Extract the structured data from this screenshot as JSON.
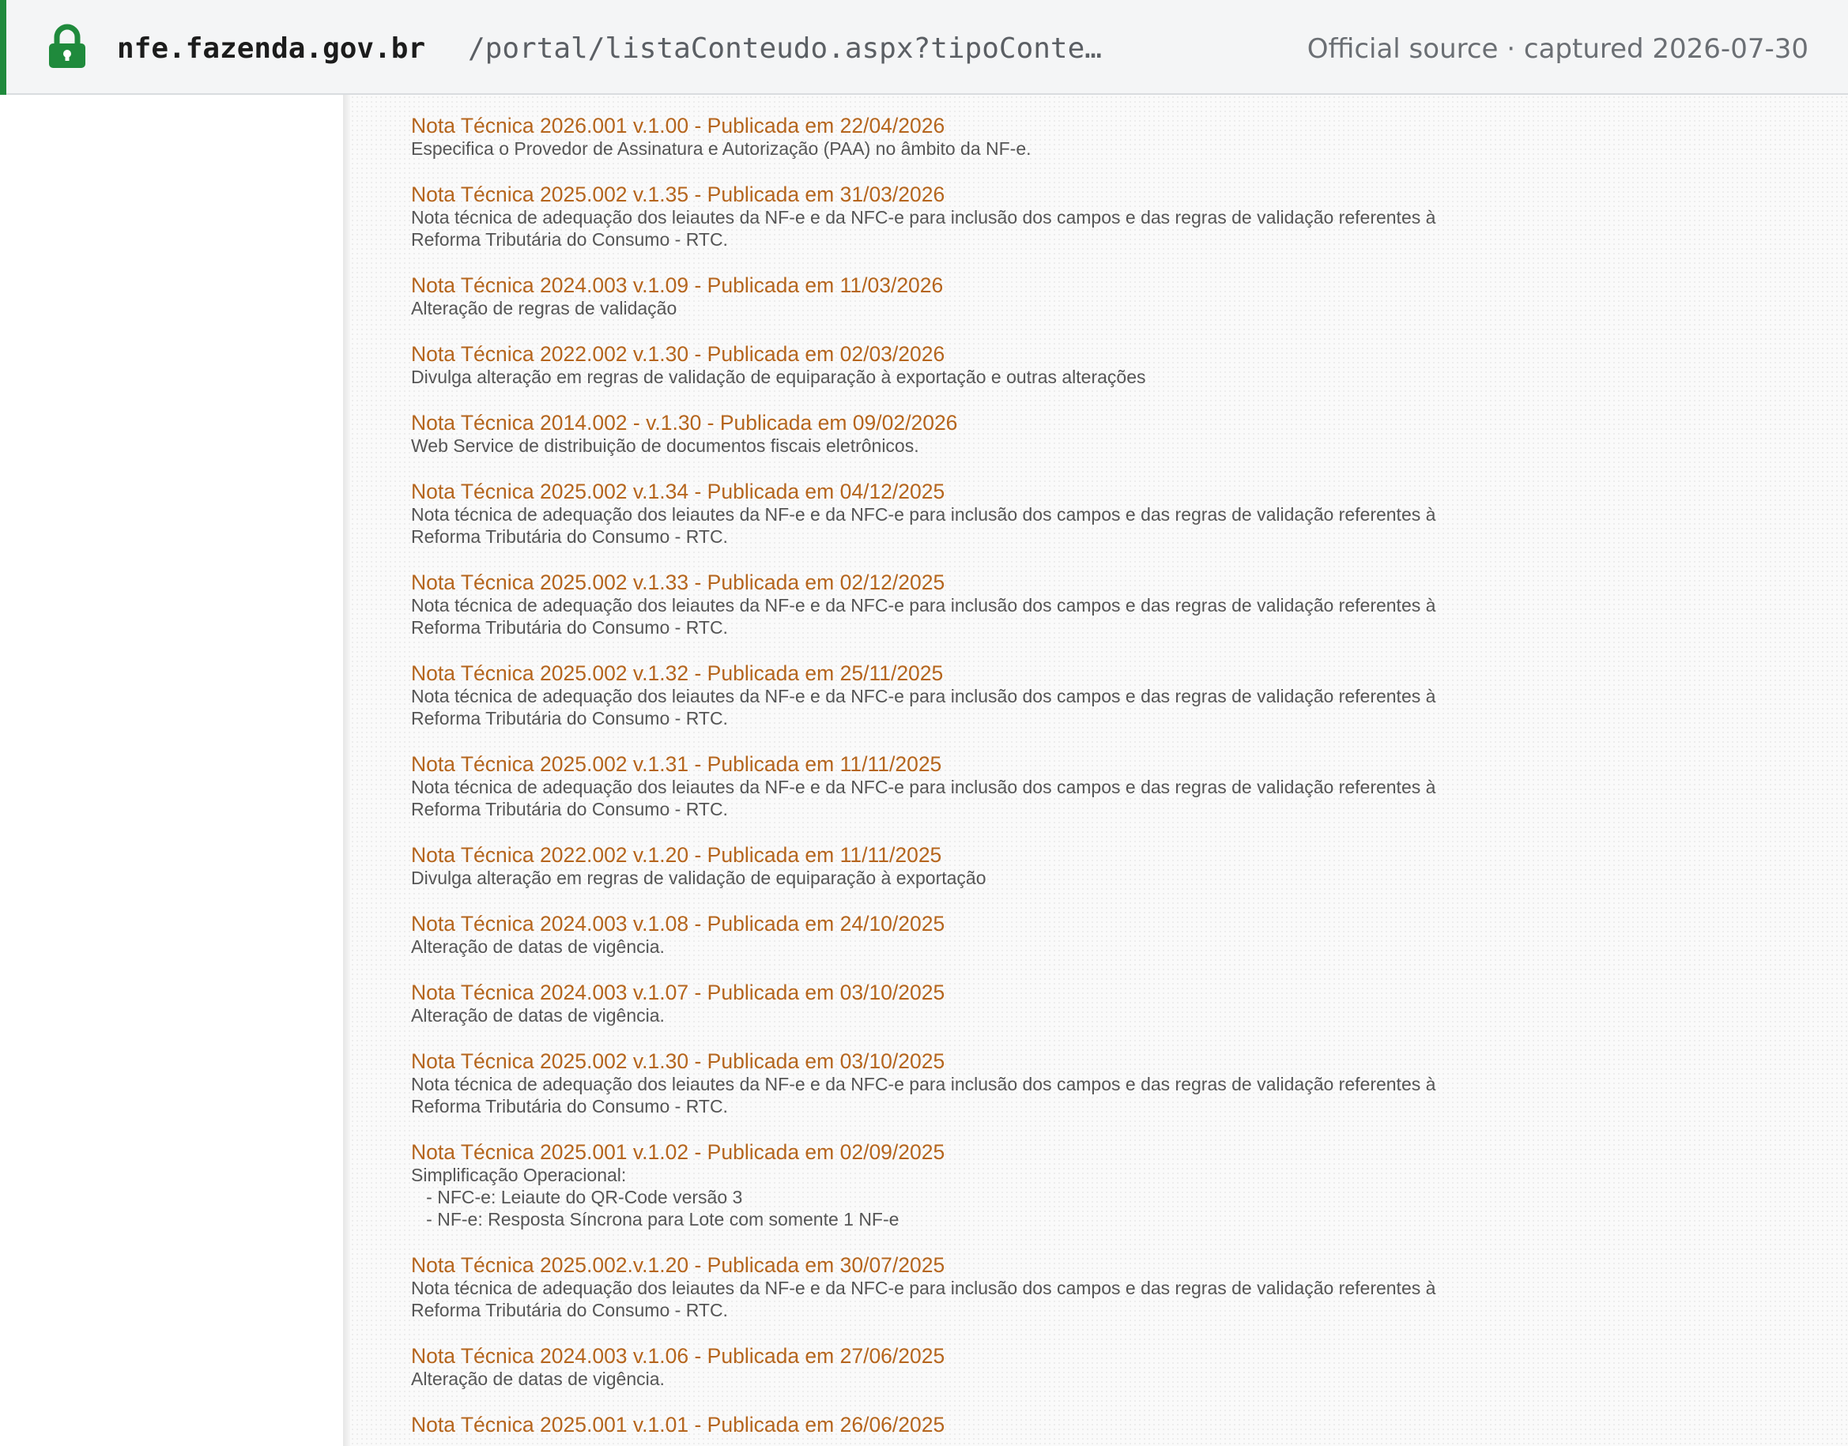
{
  "address_bar": {
    "domain": "nfe.fazenda.gov.br",
    "path": "/portal/listaConteudo.aspx?tipoConte…",
    "source": "Official source · captured 2026-07-30",
    "accent_color": "#1f8a3c",
    "icon": "lock-icon"
  },
  "colors": {
    "title": "#b5651d",
    "description": "#555555"
  },
  "notes": [
    {
      "title": "Nota Técnica 2026.001 v.1.00 - Publicada em 22/04/2026",
      "desc": "Especifica o Provedor de Assinatura e Autorização (PAA) no âmbito da NF-e."
    },
    {
      "title": "Nota Técnica 2025.002 v.1.35 - Publicada em 31/03/2026",
      "desc": "Nota técnica de adequação dos leiautes da NF-e e da NFC-e para inclusão dos campos e das regras de validação referentes à\nReforma Tributária do Consumo - RTC."
    },
    {
      "title": "Nota Técnica 2024.003 v.1.09 - Publicada em 11/03/2026",
      "desc": "Alteração de regras de validação"
    },
    {
      "title": "Nota Técnica 2022.002 v.1.30 - Publicada em 02/03/2026",
      "desc": "Divulga alteração em regras de validação de equiparação à exportação e outras alterações"
    },
    {
      "title": "Nota Técnica 2014.002 - v.1.30 - Publicada em 09/02/2026",
      "desc": "Web Service de distribuição de documentos fiscais eletrônicos."
    },
    {
      "title": "Nota Técnica 2025.002 v.1.34 - Publicada em 04/12/2025",
      "desc": "Nota técnica de adequação dos leiautes da NF-e e da NFC-e para inclusão dos campos e das regras de validação referentes à\nReforma Tributária do Consumo - RTC."
    },
    {
      "title": "Nota Técnica 2025.002 v.1.33 - Publicada em 02/12/2025",
      "desc": "Nota técnica de adequação dos leiautes da NF-e e da NFC-e para inclusão dos campos e das regras de validação referentes à\nReforma Tributária do Consumo - RTC."
    },
    {
      "title": "Nota Técnica 2025.002 v.1.32 - Publicada em 25/11/2025",
      "desc": "Nota técnica de adequação dos leiautes da NF-e e da NFC-e para inclusão dos campos e das regras de validação referentes à\nReforma Tributária do Consumo - RTC."
    },
    {
      "title": "Nota Técnica 2025.002 v.1.31 - Publicada em 11/11/2025",
      "desc": "Nota técnica de adequação dos leiautes da NF-e e da NFC-e para inclusão dos campos e das regras de validação referentes à\nReforma Tributária do Consumo - RTC."
    },
    {
      "title": "Nota Técnica 2022.002 v.1.20 - Publicada em 11/11/2025",
      "desc": "Divulga alteração em regras de validação de equiparação à exportação"
    },
    {
      "title": "Nota Técnica 2024.003 v.1.08 - Publicada em 24/10/2025",
      "desc": "Alteração de datas de vigência."
    },
    {
      "title": "Nota Técnica 2024.003 v.1.07 - Publicada em 03/10/2025",
      "desc": "Alteração de datas de vigência."
    },
    {
      "title": "Nota Técnica 2025.002 v.1.30 - Publicada em 03/10/2025",
      "desc": "Nota técnica de adequação dos leiautes da NF-e e da NFC-e para inclusão dos campos e das regras de validação referentes à\nReforma Tributária do Consumo - RTC."
    },
    {
      "title": "Nota Técnica 2025.001 v.1.02 - Publicada em 02/09/2025",
      "desc": "Simplificação Operacional:\n   - NFC-e: Leiaute do QR-Code versão 3\n   - NF-e: Resposta Síncrona para Lote com somente 1 NF-e"
    },
    {
      "title": "Nota Técnica 2025.002.v.1.20 - Publicada em 30/07/2025",
      "desc": "Nota técnica de adequação dos leiautes da NF-e e da NFC-e para inclusão dos campos e das regras de validação referentes à\nReforma Tributária do Consumo - RTC."
    },
    {
      "title": "Nota Técnica 2024.003 v.1.06 - Publicada em 27/06/2025",
      "desc": "Alteração de datas de vigência."
    },
    {
      "title": "Nota Técnica 2025.001 v.1.01 - Publicada em 26/06/2025",
      "desc": ""
    }
  ]
}
